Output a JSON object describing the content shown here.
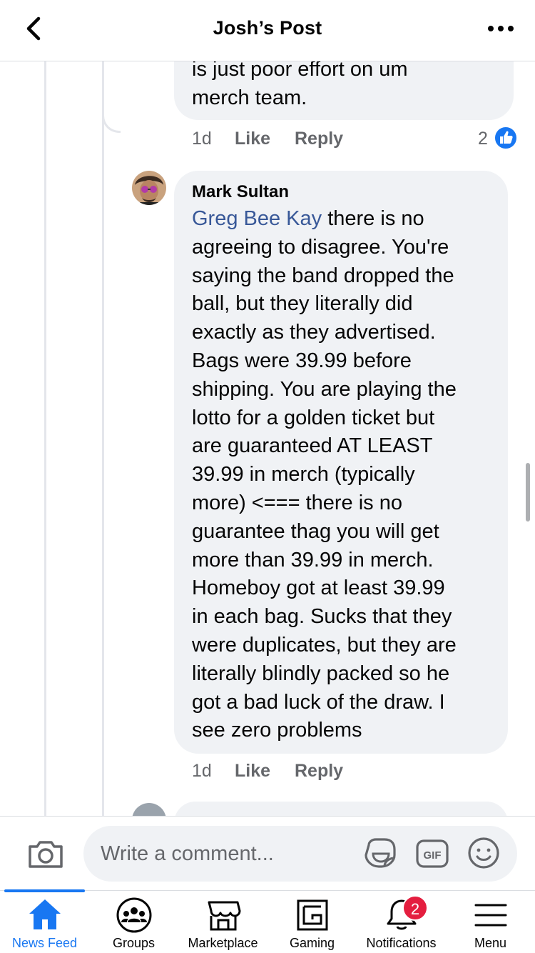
{
  "header": {
    "title": "Josh’s Post",
    "back_icon": "chevron-left-icon",
    "more_icon": "ellipsis-icon"
  },
  "previous_comment": {
    "lines": [
      "is just poor effort on um",
      "merch team."
    ],
    "time": "1d",
    "like_label": "Like",
    "reply_label": "Reply",
    "reaction_count": "2",
    "reaction_icon": "like-reaction-icon"
  },
  "reply": {
    "author": "Mark Sultan",
    "mention": "Greg Bee Kay",
    "first_line_rest": " there is no",
    "lines": [
      "agreeing to disagree. You're",
      "saying the band dropped the",
      "ball, but they literally did",
      "exactly as they advertised.",
      "Bags were 39.99 before",
      "shipping. You are playing the",
      "lotto for a golden ticket but",
      "are guaranteed AT LEAST",
      "39.99 in merch (typically",
      "more) <=== there is no",
      "guarantee thag you will get",
      "more than 39.99 in merch.",
      "Homeboy got at least 39.99",
      "in each bag. Sucks that they",
      "were duplicates, but they are",
      "literally blindly packed so he",
      "got a bad luck of the draw. I",
      "see zero problems"
    ],
    "time": "1d",
    "like_label": "Like",
    "reply_label": "Reply"
  },
  "composer": {
    "placeholder": "Write a comment...",
    "icons": [
      "camera-icon",
      "sticker-icon",
      "gif-icon",
      "emoji-icon"
    ]
  },
  "tabs": [
    {
      "label": "News Feed",
      "icon": "home-icon",
      "active": true
    },
    {
      "label": "Groups",
      "icon": "groups-icon"
    },
    {
      "label": "Marketplace",
      "icon": "marketplace-icon"
    },
    {
      "label": "Gaming",
      "icon": "gaming-icon"
    },
    {
      "label": "Notifications",
      "icon": "bell-icon",
      "badge": "2"
    },
    {
      "label": "Menu",
      "icon": "menu-icon"
    }
  ],
  "colors": {
    "accent": "#1877f2",
    "mention": "#385898",
    "bubble": "#f0f2f5",
    "badge": "#e41e3f"
  }
}
